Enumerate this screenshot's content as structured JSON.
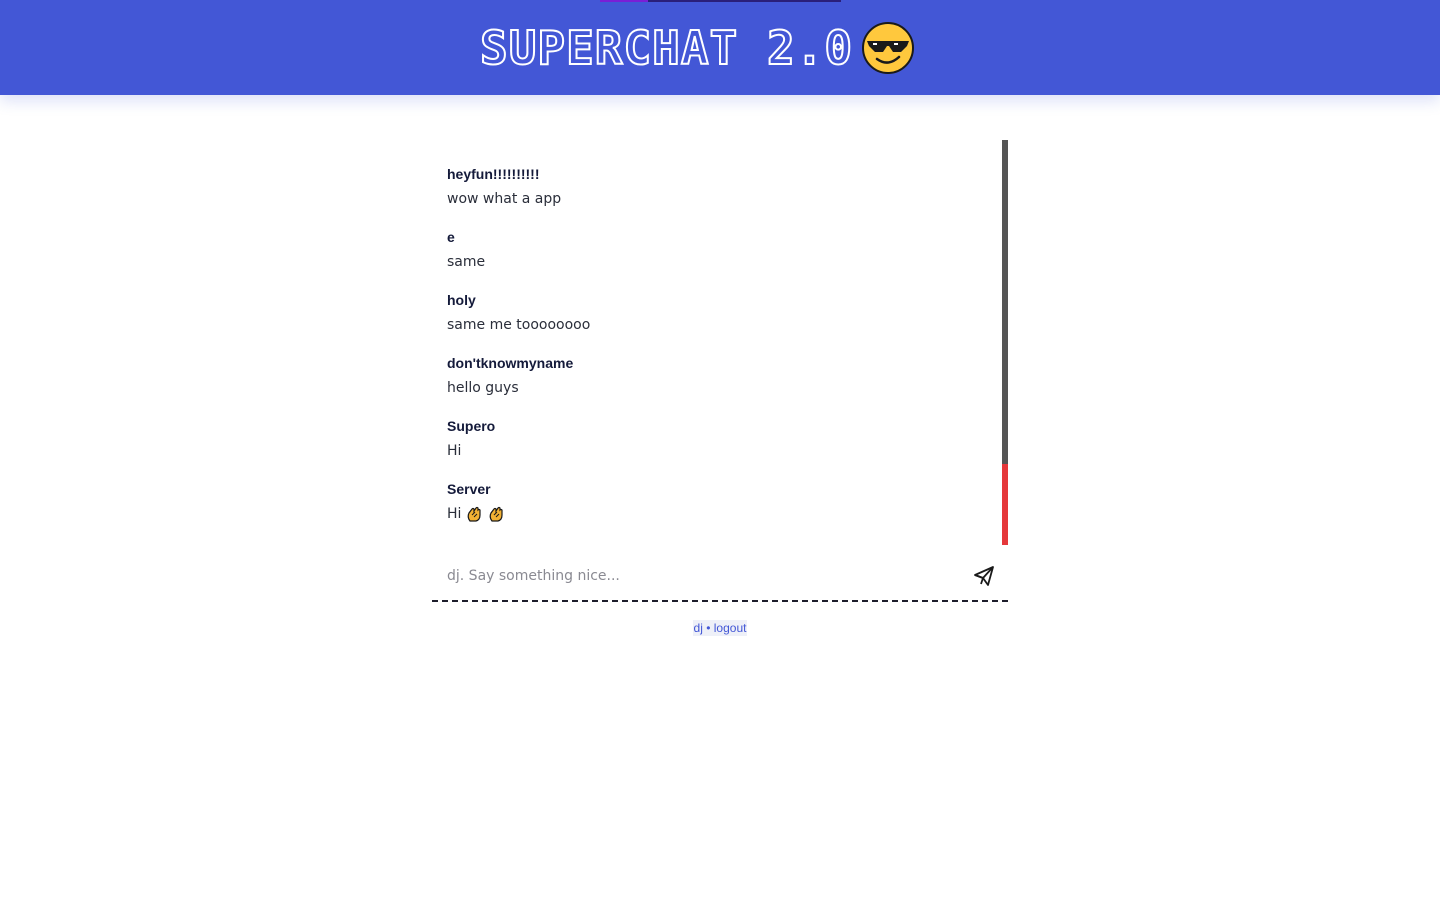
{
  "header": {
    "title": "SUPERCHAT 2.0",
    "logo_icon": "cool-sunglasses-emoji-icon",
    "background_color": "#4357d6"
  },
  "chat": {
    "partial_top_text": ",",
    "messages": [
      {
        "author": "heyfun!!!!!!!!!!",
        "text": "wow what a app"
      },
      {
        "author": "e",
        "text": "same"
      },
      {
        "author": "holy",
        "text": "same me toooooooo"
      },
      {
        "author": "don'tknowmyname",
        "text": "hello guys"
      },
      {
        "author": "Supero",
        "text": "Hi"
      },
      {
        "author": "Server",
        "text": "Hi",
        "emoji_icons": [
          "clapping-hands-icon",
          "clapping-hands-icon"
        ]
      }
    ],
    "scrollbar": {
      "track_color": "#555555",
      "thumb_color": "#e5383b",
      "scroll_position_fraction": 0.8
    }
  },
  "composer": {
    "placeholder": "dj. Say something nice...",
    "value": "",
    "send_icon": "paper-plane-send-icon"
  },
  "footer": {
    "username": "dj",
    "separator": "•",
    "logout_label": "logout"
  }
}
